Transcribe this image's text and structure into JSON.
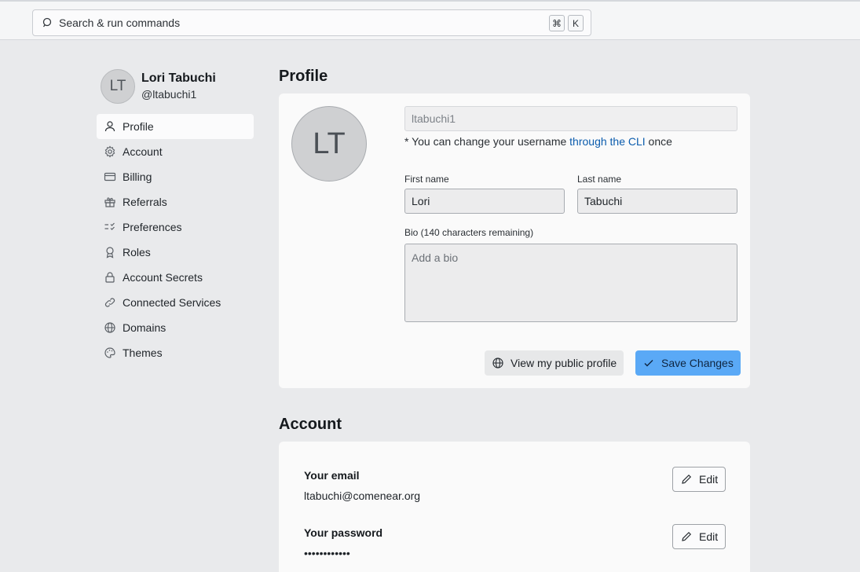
{
  "search": {
    "placeholder": "Search & run commands",
    "shortcut_keys": [
      "⌘",
      "K"
    ]
  },
  "user": {
    "initials": "LT",
    "name": "Lori Tabuchi",
    "handle": "@ltabuchi1"
  },
  "sidebar": {
    "items": [
      {
        "label": "Profile",
        "icon": "user-icon",
        "active": true
      },
      {
        "label": "Account",
        "icon": "gear-icon"
      },
      {
        "label": "Billing",
        "icon": "credit-card-icon"
      },
      {
        "label": "Referrals",
        "icon": "gift-icon"
      },
      {
        "label": "Preferences",
        "icon": "list-check-icon"
      },
      {
        "label": "Roles",
        "icon": "award-icon"
      },
      {
        "label": "Account Secrets",
        "icon": "lock-icon"
      },
      {
        "label": "Connected Services",
        "icon": "link-icon"
      },
      {
        "label": "Domains",
        "icon": "globe-icon"
      },
      {
        "label": "Themes",
        "icon": "palette-icon"
      }
    ]
  },
  "profile": {
    "title": "Profile",
    "avatar_initials": "LT",
    "username": "ltabuchi1",
    "username_note_prefix": "* You can change your username ",
    "username_note_link": "through the CLI",
    "username_note_suffix": " once",
    "first_name_label": "First name",
    "first_name": "Lori",
    "last_name_label": "Last name",
    "last_name": "Tabuchi",
    "bio_label": "Bio (140 characters remaining)",
    "bio_placeholder": "Add a bio",
    "view_public_label": "View my public profile",
    "save_label": "Save Changes"
  },
  "account": {
    "title": "Account",
    "email_label": "Your email",
    "email": "ltabuchi@comenear.org",
    "password_label": "Your password",
    "password": "••••••••••••",
    "edit_label": "Edit"
  },
  "colors": {
    "accent": "#5aa9f6",
    "link": "#0b5cad",
    "background": "#e9eaec"
  }
}
